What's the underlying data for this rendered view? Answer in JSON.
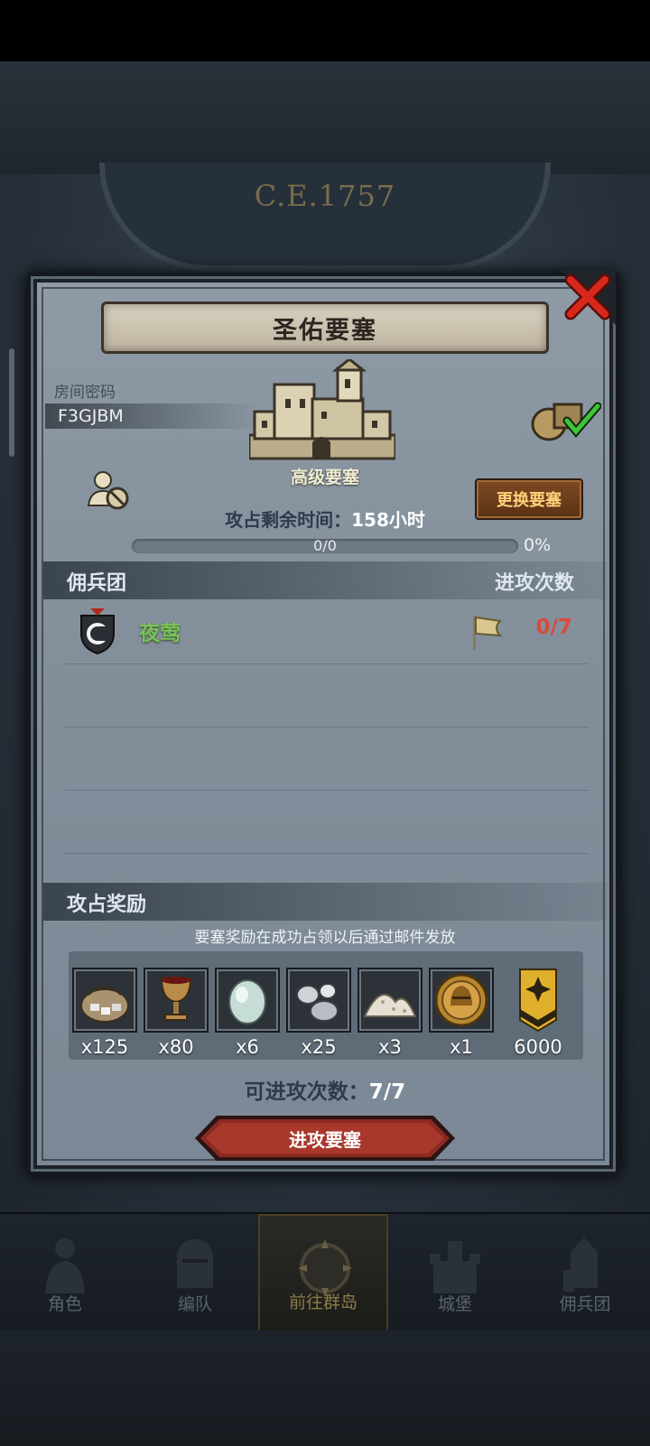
{
  "background": {
    "year": "C.E.1757"
  },
  "dialog": {
    "title": "圣佑要塞",
    "room_label": "房间密码",
    "room_code": "F3GJBM",
    "fortress_level": "高级要塞",
    "change_button": "更换要塞",
    "remain_label": "攻占剩余时间：",
    "remain_value": "158小时",
    "progress_text": "0/0",
    "progress_fraction": 0,
    "progress_pct": "0%",
    "mercenary_header": "佣兵团",
    "attack_times_header": "进攻次数",
    "mercenaries": [
      {
        "name": "夜莺",
        "count": "0/7"
      }
    ],
    "reward_header": "攻占奖励",
    "reward_note": "要塞奖励在成功占领以后通过邮件发放",
    "rewards": [
      {
        "icon": "stone-sack-icon",
        "qty": "x125"
      },
      {
        "icon": "goblet-icon",
        "qty": "x80"
      },
      {
        "icon": "gem-icon",
        "qty": "x6"
      },
      {
        "icon": "silver-ore-icon",
        "qty": "x25"
      },
      {
        "icon": "powder-icon",
        "qty": "x3"
      },
      {
        "icon": "helmet-medal-icon",
        "qty": "x1"
      },
      {
        "icon": "rank-badge-icon",
        "qty": "6000"
      }
    ],
    "attack_count_label": "可进攻次数：",
    "attack_count_value": "7/7",
    "attack_button": "进攻要塞"
  },
  "bottom_nav": [
    {
      "label": "角色",
      "icon": "character-icon",
      "active": false
    },
    {
      "label": "编队",
      "icon": "knight-helmet-icon",
      "active": false
    },
    {
      "label": "前往群岛",
      "icon": "compass-icon",
      "active": true
    },
    {
      "label": "城堡",
      "icon": "castle-icon",
      "active": false
    },
    {
      "label": "佣兵团",
      "icon": "mercenary-icon",
      "active": false
    }
  ],
  "colors": {
    "accent_green": "#7ac25a",
    "count_red": "#d94a3a",
    "change_button_text": "#ffd27a"
  }
}
